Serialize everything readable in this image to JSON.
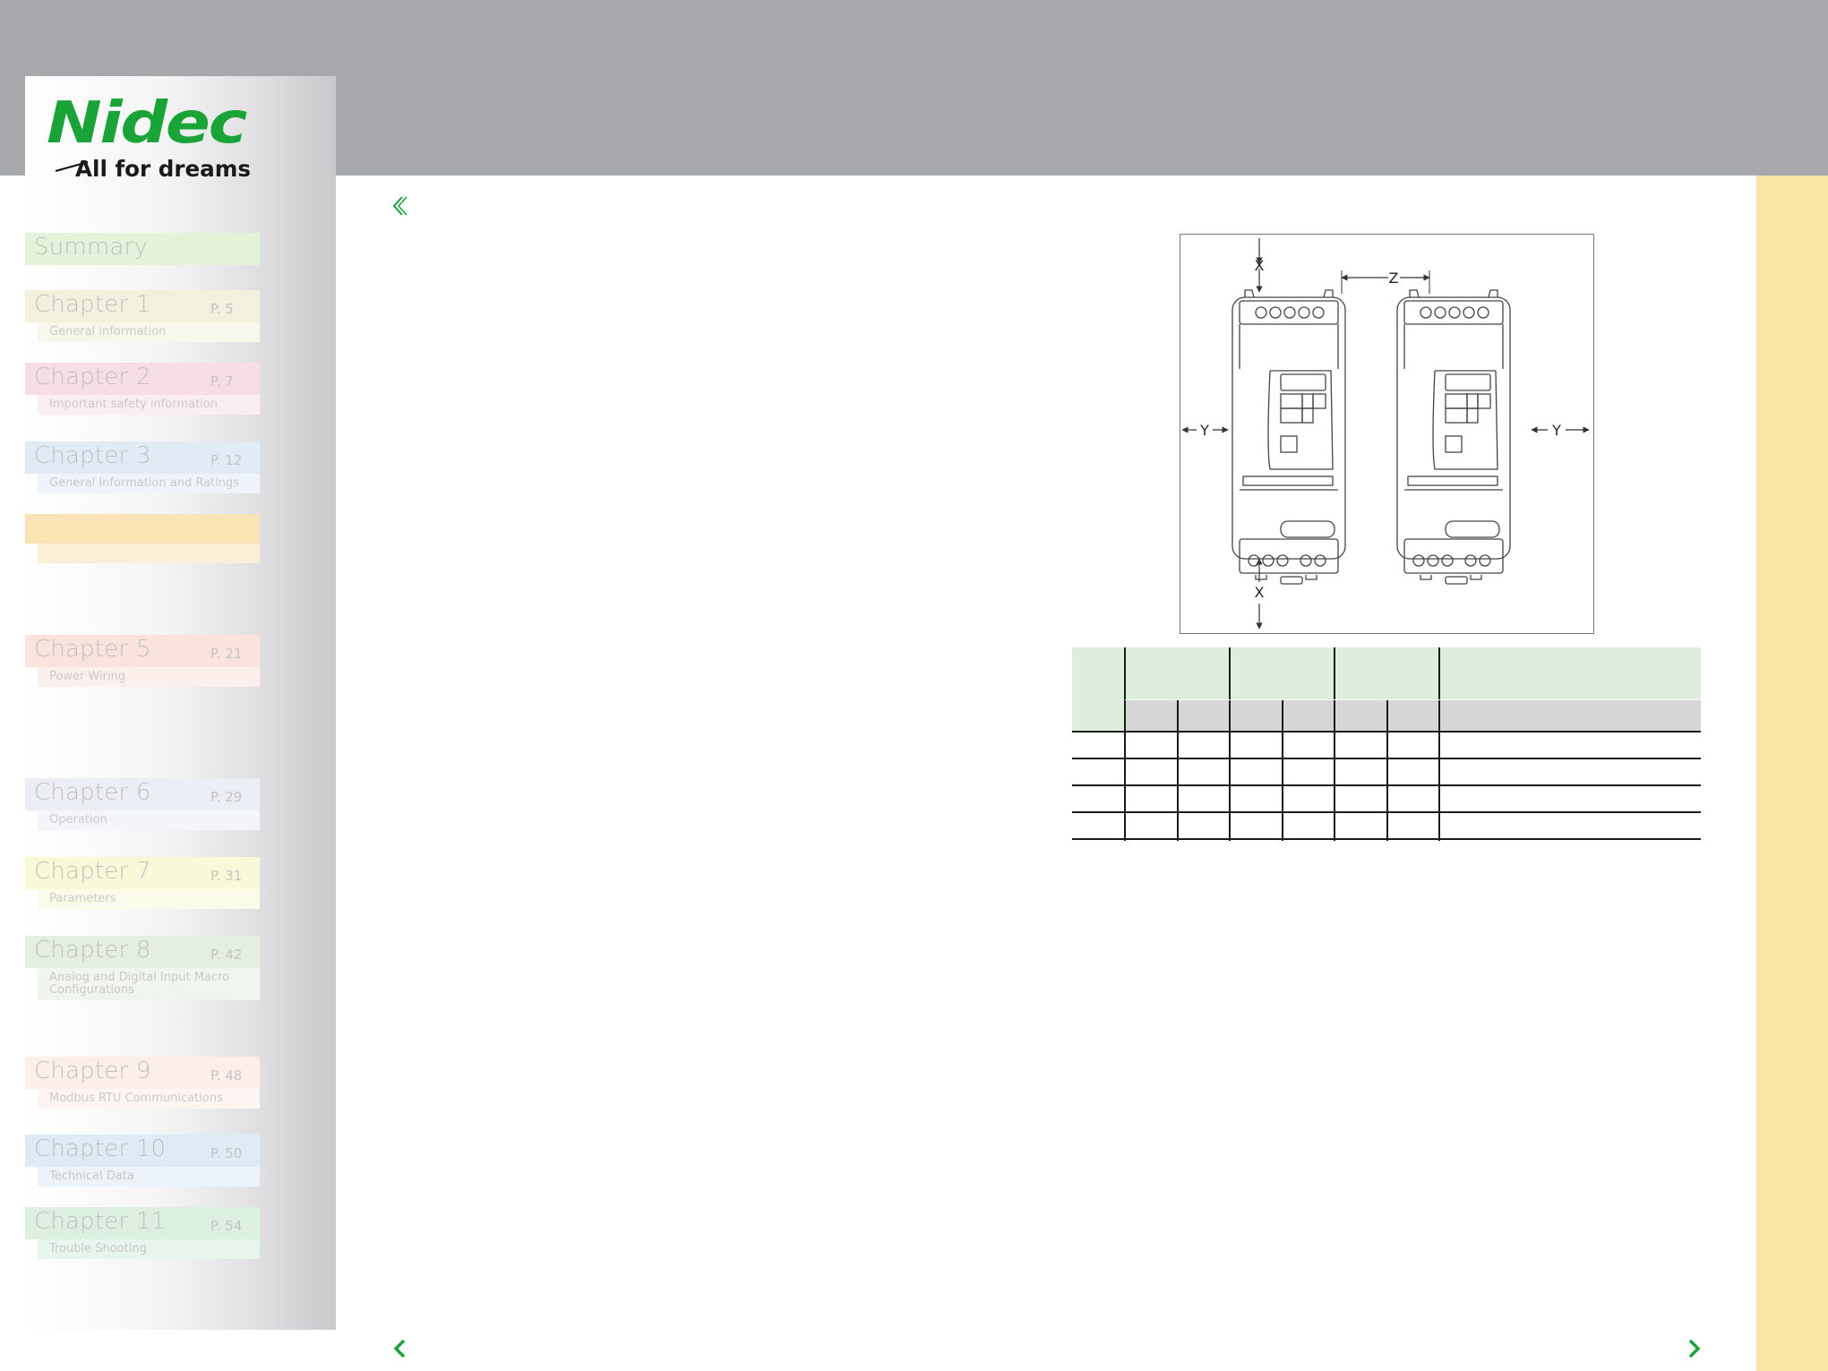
{
  "brand": {
    "name": "Nidec",
    "tagline": "All for dreams",
    "color": "#1aa336"
  },
  "sidebar": {
    "items": [
      {
        "title": "Summary",
        "page": "",
        "subtitle": "",
        "color": "#e4f2d9"
      },
      {
        "title": "Chapter 1",
        "page": "P. 5",
        "subtitle": "General information",
        "color": "#f3f1dd"
      },
      {
        "title": "Chapter 2",
        "page": "P. 7",
        "subtitle": "Important safety information",
        "color": "#f7dde6"
      },
      {
        "title": "Chapter 3",
        "page": "P. 12",
        "subtitle": "General Information and Ratings",
        "color": "#e1ebf6"
      },
      {
        "title": "",
        "page": "",
        "subtitle": "",
        "color": "#fbe4b4"
      },
      {
        "title": "Chapter 5",
        "page": "P. 21",
        "subtitle": "Power Wiring",
        "color": "#fae3dc"
      },
      {
        "title": "Chapter 6",
        "page": "P. 29",
        "subtitle": "Operation",
        "color": "#eceef5"
      },
      {
        "title": "Chapter 7",
        "page": "P. 31",
        "subtitle": "Parameters",
        "color": "#f9f8d7"
      },
      {
        "title": "Chapter 8",
        "page": "P. 42",
        "subtitle": "Analog and Digital Input Macro Configurations",
        "color": "#e4efe0"
      },
      {
        "title": "Chapter 9",
        "page": "P. 48",
        "subtitle": "Modbus RTU Communications",
        "color": "#fcefe9"
      },
      {
        "title": "Chapter 10",
        "page": "P. 50",
        "subtitle": "Technical Data",
        "color": "#ddebf5"
      },
      {
        "title": "Chapter 11",
        "page": "P. 54",
        "subtitle": "Trouble Shooting",
        "color": "#dcf0e2"
      }
    ]
  },
  "figure": {
    "labels": {
      "top": "X",
      "bottom": "X",
      "left": "Y",
      "right": "Y",
      "gap": "Z"
    }
  },
  "colors": {
    "top_band": "#a6a8ab",
    "right_strip": "#f7e4a6",
    "table_header": "#dceedc",
    "table_subheader": "#d6d6d7"
  }
}
